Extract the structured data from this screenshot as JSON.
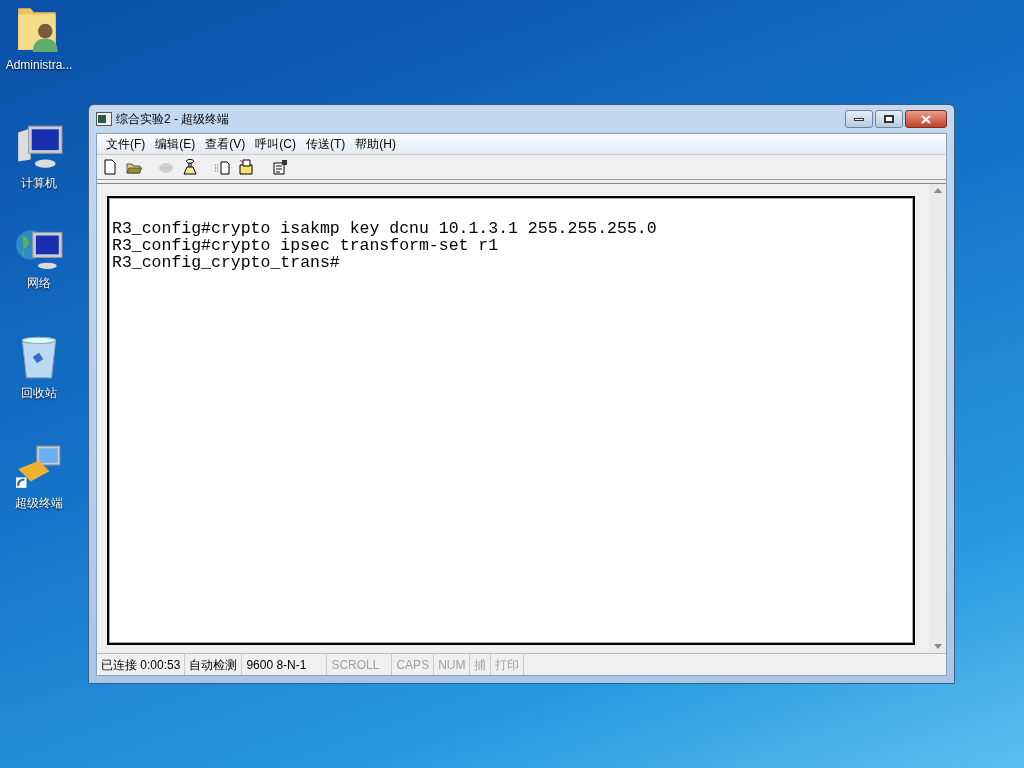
{
  "desktop_icons": [
    {
      "kind": "user-folder",
      "label": "Administra..."
    },
    {
      "kind": "computer",
      "label": "计算机"
    },
    {
      "kind": "network",
      "label": "网络"
    },
    {
      "kind": "recycle-bin",
      "label": "回收站"
    },
    {
      "kind": "terminal-shortcut",
      "label": "超级终端"
    }
  ],
  "window": {
    "title": "综合实验2 - 超级终端"
  },
  "menu": [
    "文件(F)",
    "编辑(E)",
    "查看(V)",
    "呼叫(C)",
    "传送(T)",
    "帮助(H)"
  ],
  "toolbar": [
    {
      "kind": "new",
      "disabled": false
    },
    {
      "kind": "open",
      "disabled": false
    },
    {
      "kind": "hang-up",
      "disabled": true
    },
    {
      "kind": "dial",
      "disabled": false
    },
    {
      "kind": "send",
      "disabled": false
    },
    {
      "kind": "receive",
      "disabled": false
    },
    {
      "kind": "properties",
      "disabled": false
    }
  ],
  "terminal_lines": [
    "R3_config#crypto isakmp key dcnu 10.1.3.1 255.255.255.0",
    "R3_config#crypto ipsec transform-set r1",
    "R3_config_crypto_trans#"
  ],
  "status_bar": [
    {
      "text": "已连接 0:00:53",
      "enabled": true
    },
    {
      "text": "自动检测",
      "enabled": true
    },
    {
      "text": "9600 8-N-1",
      "enabled": true
    },
    {
      "text": "SCROLL",
      "enabled": false
    },
    {
      "text": "CAPS",
      "enabled": false
    },
    {
      "text": "NUM",
      "enabled": false
    },
    {
      "text": "捕",
      "enabled": false
    },
    {
      "text": "打印",
      "enabled": false
    }
  ]
}
